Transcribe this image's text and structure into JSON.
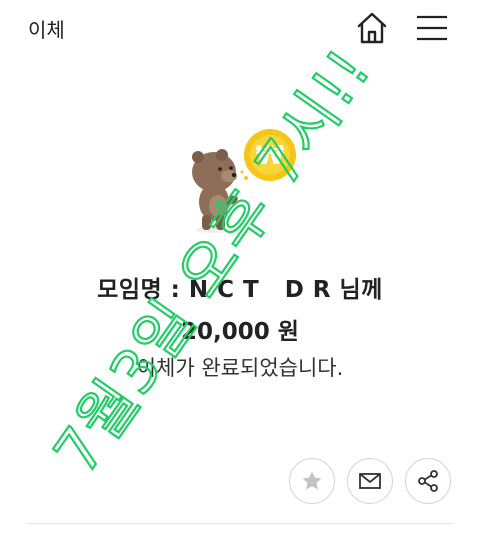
{
  "header": {
    "title": "이체",
    "home_icon": "home-icon",
    "menu_icon": "hamburger-menu-icon"
  },
  "illustration": {
    "character": "bear-character",
    "coin_symbol": "₩",
    "coin_color": "#F5C518"
  },
  "receipt": {
    "recipient": "모임명 : N C T   D R 님께",
    "amount": "20,000 원",
    "status": "이체가 완료되었습니다."
  },
  "actions": [
    {
      "icon": "star-icon"
    },
    {
      "icon": "mail-icon"
    },
    {
      "icon": "share-icon"
    }
  ],
  "annotation": {
    "text": "7월3일 오후 7시!!",
    "color": "#22CC66"
  }
}
